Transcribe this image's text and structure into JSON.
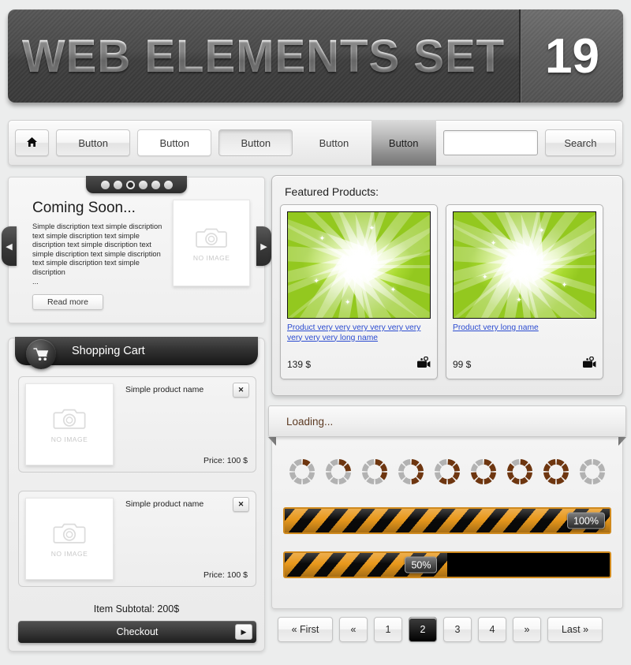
{
  "banner": {
    "title": "WEB ELEMENTS SET",
    "number": "19"
  },
  "navbar": {
    "home_icon": "home-icon",
    "buttons": [
      {
        "label": "Button",
        "state": "normal"
      },
      {
        "label": "Button",
        "state": "hover"
      },
      {
        "label": "Button",
        "state": "pressed"
      },
      {
        "label": "Button",
        "state": "flat"
      },
      {
        "label": "Button",
        "state": "active"
      }
    ],
    "search": {
      "value": "",
      "placeholder": "",
      "icon": "search-plus-icon",
      "button_label": "Search"
    }
  },
  "slider": {
    "dots": 6,
    "active_dot": 2,
    "prev_icon": "chevron-left-icon",
    "next_icon": "chevron-right-icon",
    "heading": "Coming Soon...",
    "body": "Simple discription text simple discription text simple discription text simple discription text simple discription text simple discription text simple discription text simple discription text simple discription",
    "ellipsis": "...",
    "read_more_label": "Read more",
    "placeholder": {
      "icon": "camera-icon",
      "label": "NO IMAGE"
    }
  },
  "featured": {
    "title": "Featured Products:",
    "products": [
      {
        "name": "Product very very very very very very very very very long name",
        "price": "139 $",
        "media_icon": "video-camera-icon"
      },
      {
        "name": "Product very long name",
        "price": "99 $",
        "media_icon": "video-camera-icon"
      }
    ]
  },
  "cart": {
    "icon": "shopping-cart-icon",
    "title": "Shopping Cart",
    "items": [
      {
        "name": "Simple product name",
        "price": "Price: 100 $",
        "close_icon": "close-icon",
        "placeholder_label": "NO IMAGE"
      },
      {
        "name": "Simple product name",
        "price": "Price: 100 $",
        "close_icon": "close-icon",
        "placeholder_label": "NO IMAGE"
      }
    ],
    "subtotal": "Item Subtotal: 200$",
    "checkout_label": "Checkout",
    "checkout_arrow_icon": "arrow-right-icon"
  },
  "loading": {
    "label": "Loading...",
    "spinner_frames": [
      1,
      2,
      3,
      4,
      5,
      6,
      7,
      8,
      0
    ],
    "spinner_segments": 8,
    "spinner_active_color": "#6e3610",
    "spinner_idle_color": "#b2b2b2",
    "bars": [
      {
        "percent": 100,
        "label": "100%"
      },
      {
        "percent": 50,
        "label": "50%"
      }
    ],
    "bar_stripe_color": "#e8981c",
    "bar_border_color": "#d08a1e"
  },
  "pagination": {
    "active_page": "2",
    "items": [
      {
        "label": "« First",
        "kind": "wide"
      },
      {
        "label": "«",
        "kind": "normal"
      },
      {
        "label": "1",
        "kind": "normal"
      },
      {
        "label": "2",
        "kind": "normal"
      },
      {
        "label": "3",
        "kind": "normal"
      },
      {
        "label": "4",
        "kind": "normal"
      },
      {
        "label": "»",
        "kind": "normal"
      },
      {
        "label": "Last »",
        "kind": "wide"
      }
    ]
  }
}
